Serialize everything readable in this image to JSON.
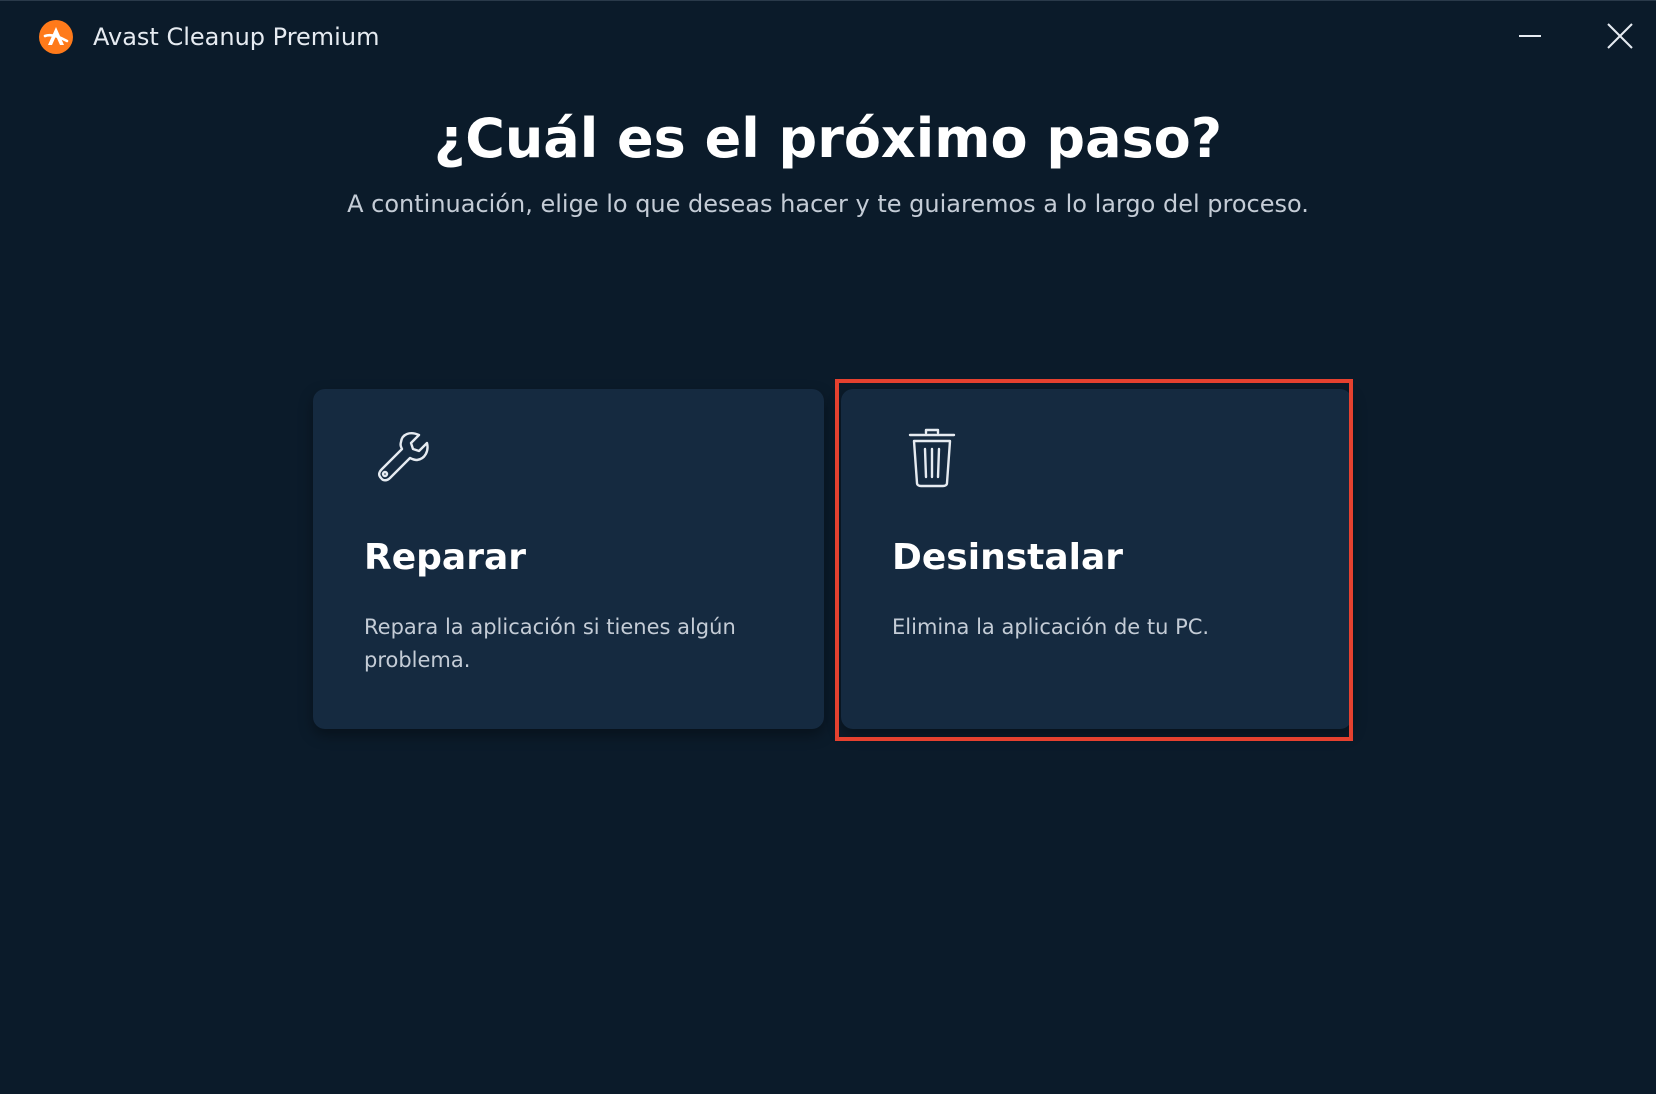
{
  "window": {
    "title": "Avast Cleanup Premium",
    "logo_icon": "avast-logo-icon",
    "controls": {
      "minimize_icon": "minimize-icon",
      "close_icon": "close-icon"
    }
  },
  "main": {
    "headline": "¿Cuál es el próximo paso?",
    "subheadline": "A continuación, elige lo que deseas hacer y te guiaremos a lo largo del proceso."
  },
  "options": [
    {
      "icon": "wrench-icon",
      "title": "Reparar",
      "description": "Repara la aplicación si tienes algún problema."
    },
    {
      "icon": "trash-icon",
      "title": "Desinstalar",
      "description": "Elimina la aplicación de tu PC.",
      "highlighted": true
    }
  ],
  "colors": {
    "background": "#0b1b2a",
    "card": "#152a40",
    "accent_logo": "#ff7a1a",
    "highlight_border": "#e5412f",
    "text_primary": "#ffffff",
    "text_secondary": "#c4ccd6"
  }
}
